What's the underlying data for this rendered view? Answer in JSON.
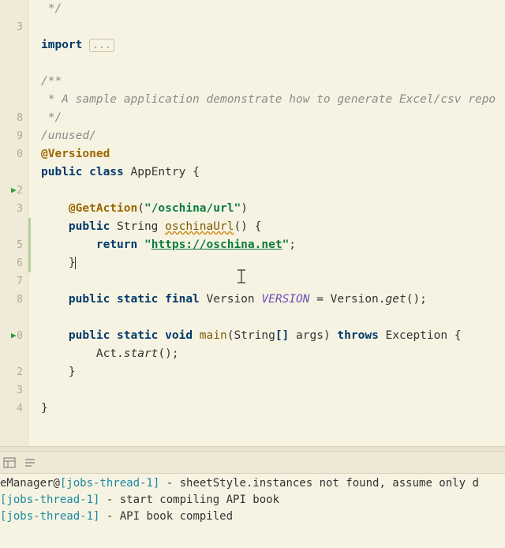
{
  "gutter": {
    "visible_numbers": [
      "",
      "3",
      "",
      "",
      "",
      "",
      "8",
      "9",
      "0",
      "",
      "2",
      "3",
      "",
      "5",
      "6",
      "7",
      "8",
      "",
      "0",
      "",
      "2",
      "3",
      "4",
      ""
    ],
    "run_markers": [
      {
        "line_index": 10,
        "symbol": "▶"
      },
      {
        "line_index": 18,
        "symbol": "▶"
      }
    ]
  },
  "code": {
    "lines": [
      {
        "segments": [
          {
            "text": " */",
            "cls": "comment"
          }
        ]
      },
      {
        "segments": []
      },
      {
        "segments": [
          {
            "text": "import ",
            "cls": "keyword-dark"
          },
          {
            "text": "...",
            "cls": "fold-box"
          }
        ]
      },
      {
        "segments": []
      },
      {
        "segments": [
          {
            "text": "/**",
            "cls": "comment"
          }
        ]
      },
      {
        "segments": [
          {
            "text": " * A sample application demonstrate how to generate Excel/csv repo",
            "cls": "comment"
          }
        ]
      },
      {
        "segments": [
          {
            "text": " */",
            "cls": "comment"
          }
        ]
      },
      {
        "segments": [
          {
            "text": "/unused/",
            "cls": "comment"
          }
        ]
      },
      {
        "segments": [
          {
            "text": "@Versioned",
            "cls": "annotation"
          }
        ]
      },
      {
        "segments": [
          {
            "text": "public class ",
            "cls": "keyword-dark"
          },
          {
            "text": "AppEntry ",
            "cls": "classname"
          },
          {
            "text": "{",
            "cls": "brace"
          }
        ]
      },
      {
        "segments": []
      },
      {
        "segments": [
          {
            "text": "    ",
            "cls": ""
          },
          {
            "text": "@GetAction",
            "cls": "annotation"
          },
          {
            "text": "(",
            "cls": "brace"
          },
          {
            "text": "\"/oschina/url\"",
            "cls": "string"
          },
          {
            "text": ")",
            "cls": "brace"
          }
        ]
      },
      {
        "segments": [
          {
            "text": "    ",
            "cls": ""
          },
          {
            "text": "public ",
            "cls": "keyword-dark"
          },
          {
            "text": "String ",
            "cls": "type"
          },
          {
            "text": "oschinaUrl",
            "cls": "methoddecl underline-err"
          },
          {
            "text": "() ",
            "cls": "brace"
          },
          {
            "text": "{",
            "cls": "brace"
          }
        ]
      },
      {
        "segments": [
          {
            "text": "        ",
            "cls": ""
          },
          {
            "text": "return ",
            "cls": "keyword-dark"
          },
          {
            "text": "\"",
            "cls": "string"
          },
          {
            "text": "https://oschina.net",
            "cls": "url-string"
          },
          {
            "text": "\"",
            "cls": "string"
          },
          {
            "text": ";",
            "cls": "brace"
          }
        ]
      },
      {
        "segments": [
          {
            "text": "    }",
            "cls": "brace"
          },
          {
            "text": "",
            "cls": "code-cursor"
          }
        ]
      },
      {
        "segments": []
      },
      {
        "segments": [
          {
            "text": "    ",
            "cls": ""
          },
          {
            "text": "public static final ",
            "cls": "keyword-dark"
          },
          {
            "text": "Version ",
            "cls": "type"
          },
          {
            "text": "VERSION",
            "cls": "const-italic"
          },
          {
            "text": " = Version.",
            "cls": ""
          },
          {
            "text": "get",
            "cls": "call-italic"
          },
          {
            "text": "();",
            "cls": "brace"
          }
        ]
      },
      {
        "segments": []
      },
      {
        "segments": [
          {
            "text": "    ",
            "cls": ""
          },
          {
            "text": "public static void ",
            "cls": "keyword-dark"
          },
          {
            "text": "main",
            "cls": "methoddecl"
          },
          {
            "text": "(String",
            "cls": "brace"
          },
          {
            "text": "[] ",
            "cls": "keyword-dark"
          },
          {
            "text": "args",
            "cls": "param"
          },
          {
            "text": ") ",
            "cls": "brace"
          },
          {
            "text": "throws ",
            "cls": "keyword-dark"
          },
          {
            "text": "Exception ",
            "cls": "type"
          },
          {
            "text": "{",
            "cls": "brace"
          }
        ]
      },
      {
        "segments": [
          {
            "text": "        Act.",
            "cls": ""
          },
          {
            "text": "start",
            "cls": "call-italic"
          },
          {
            "text": "();",
            "cls": "brace"
          }
        ]
      },
      {
        "segments": [
          {
            "text": "    }",
            "cls": "brace"
          }
        ]
      },
      {
        "segments": []
      },
      {
        "segments": [
          {
            "text": "}",
            "cls": "brace"
          }
        ]
      },
      {
        "segments": []
      }
    ]
  },
  "console": {
    "lines": [
      {
        "segments": [
          {
            "text": "eManager@",
            "cls": "console-plain"
          },
          {
            "text": "[jobs-thread-1]",
            "cls": "console-thread"
          },
          {
            "text": " - sheetStyle.instances not found, assume only d",
            "cls": "console-plain"
          }
        ]
      },
      {
        "segments": [
          {
            "text": "[jobs-thread-1]",
            "cls": "console-thread"
          },
          {
            "text": " - start compiling API book",
            "cls": "console-plain"
          }
        ]
      },
      {
        "segments": [
          {
            "text": "[jobs-thread-1]",
            "cls": "console-thread"
          },
          {
            "text": " - API book compiled",
            "cls": "console-plain"
          }
        ]
      }
    ]
  }
}
